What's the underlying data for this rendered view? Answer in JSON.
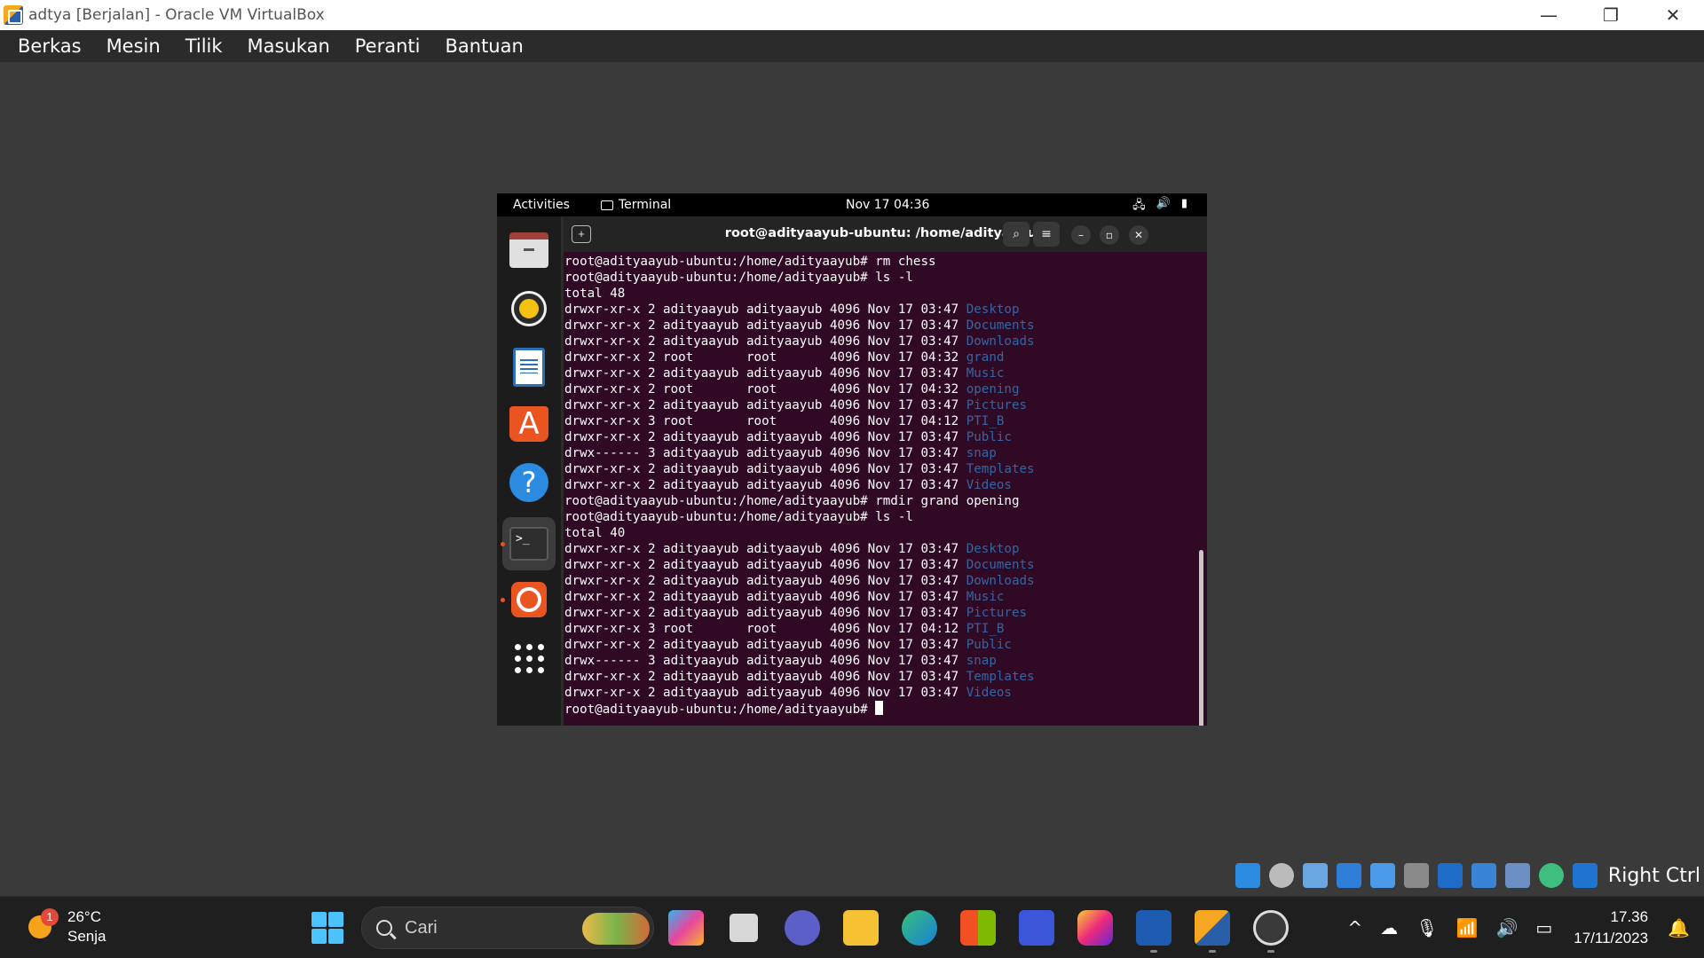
{
  "window": {
    "title": "adtya [Berjalan] - Oracle VM VirtualBox",
    "minimize_glyph": "—",
    "restore_glyph": "❐",
    "close_glyph": "✕"
  },
  "menubar": [
    "Berkas",
    "Mesin",
    "Tilik",
    "Masukan",
    "Peranti",
    "Bantuan"
  ],
  "guest": {
    "topbar": {
      "activities": "Activities",
      "app_name": "Terminal",
      "clock": "Nov 17  04:36"
    },
    "dock_items": [
      "files-icon",
      "rhythmbox-icon",
      "libreoffice-writer-icon",
      "app-center-icon",
      "help-icon",
      "terminal-icon",
      "ubuntu-icon",
      "show-apps-icon"
    ],
    "terminal": {
      "title": "root@adityaayub-ubuntu: /home/adityaayub",
      "lines": [
        [
          {
            "t": "root@adityaayub-ubuntu:/home/adityaayub# rm chess"
          }
        ],
        [
          {
            "t": "root@adityaayub-ubuntu:/home/adityaayub# ls -l"
          }
        ],
        [
          {
            "t": "total 48"
          }
        ],
        [
          {
            "t": "drwxr-xr-x 2 adityaayub adityaayub 4096 Nov 17 03:47 "
          },
          {
            "t": "Desktop",
            "c": "dir"
          }
        ],
        [
          {
            "t": "drwxr-xr-x 2 adityaayub adityaayub 4096 Nov 17 03:47 "
          },
          {
            "t": "Documents",
            "c": "dir"
          }
        ],
        [
          {
            "t": "drwxr-xr-x 2 adityaayub adityaayub 4096 Nov 17 03:47 "
          },
          {
            "t": "Downloads",
            "c": "dir"
          }
        ],
        [
          {
            "t": "drwxr-xr-x 2 root       root       4096 Nov 17 04:32 "
          },
          {
            "t": "grand",
            "c": "dir"
          }
        ],
        [
          {
            "t": "drwxr-xr-x 2 adityaayub adityaayub 4096 Nov 17 03:47 "
          },
          {
            "t": "Music",
            "c": "dir"
          }
        ],
        [
          {
            "t": "drwxr-xr-x 2 root       root       4096 Nov 17 04:32 "
          },
          {
            "t": "opening",
            "c": "dir"
          }
        ],
        [
          {
            "t": "drwxr-xr-x 2 adityaayub adityaayub 4096 Nov 17 03:47 "
          },
          {
            "t": "Pictures",
            "c": "dir"
          }
        ],
        [
          {
            "t": "drwxr-xr-x 3 root       root       4096 Nov 17 04:12 "
          },
          {
            "t": "PTI_B",
            "c": "dir"
          }
        ],
        [
          {
            "t": "drwxr-xr-x 2 adityaayub adityaayub 4096 Nov 17 03:47 "
          },
          {
            "t": "Public",
            "c": "dir"
          }
        ],
        [
          {
            "t": "drwx------ 3 adityaayub adityaayub 4096 Nov 17 03:47 "
          },
          {
            "t": "snap",
            "c": "dir"
          }
        ],
        [
          {
            "t": "drwxr-xr-x 2 adityaayub adityaayub 4096 Nov 17 03:47 "
          },
          {
            "t": "Templates",
            "c": "dir"
          }
        ],
        [
          {
            "t": "drwxr-xr-x 2 adityaayub adityaayub 4096 Nov 17 03:47 "
          },
          {
            "t": "Videos",
            "c": "dir"
          }
        ],
        [
          {
            "t": "root@adityaayub-ubuntu:/home/adityaayub# rmdir grand opening"
          }
        ],
        [
          {
            "t": "root@adityaayub-ubuntu:/home/adityaayub# ls -l"
          }
        ],
        [
          {
            "t": "total 40"
          }
        ],
        [
          {
            "t": "drwxr-xr-x 2 adityaayub adityaayub 4096 Nov 17 03:47 "
          },
          {
            "t": "Desktop",
            "c": "dir"
          }
        ],
        [
          {
            "t": "drwxr-xr-x 2 adityaayub adityaayub 4096 Nov 17 03:47 "
          },
          {
            "t": "Documents",
            "c": "dir"
          }
        ],
        [
          {
            "t": "drwxr-xr-x 2 adityaayub adityaayub 4096 Nov 17 03:47 "
          },
          {
            "t": "Downloads",
            "c": "dir"
          }
        ],
        [
          {
            "t": "drwxr-xr-x 2 adityaayub adityaayub 4096 Nov 17 03:47 "
          },
          {
            "t": "Music",
            "c": "dir"
          }
        ],
        [
          {
            "t": "drwxr-xr-x 2 adityaayub adityaayub 4096 Nov 17 03:47 "
          },
          {
            "t": "Pictures",
            "c": "dir"
          }
        ],
        [
          {
            "t": "drwxr-xr-x 3 root       root       4096 Nov 17 04:12 "
          },
          {
            "t": "PTI_B",
            "c": "dir"
          }
        ],
        [
          {
            "t": "drwxr-xr-x 2 adityaayub adityaayub 4096 Nov 17 03:47 "
          },
          {
            "t": "Public",
            "c": "dir"
          }
        ],
        [
          {
            "t": "drwx------ 3 adityaayub adityaayub 4096 Nov 17 03:47 "
          },
          {
            "t": "snap",
            "c": "dir"
          }
        ],
        [
          {
            "t": "drwxr-xr-x 2 adityaayub adityaayub 4096 Nov 17 03:47 "
          },
          {
            "t": "Templates",
            "c": "dir"
          }
        ],
        [
          {
            "t": "drwxr-xr-x 2 adityaayub adityaayub 4096 Nov 17 03:47 "
          },
          {
            "t": "Videos",
            "c": "dir"
          }
        ],
        [
          {
            "t": "root@adityaayub-ubuntu:/home/adityaayub# "
          },
          {
            "t": "",
            "c": "cursor"
          }
        ]
      ]
    }
  },
  "vbox_status": {
    "host_key": "Right Ctrl",
    "icons": [
      "hard-disk-icon",
      "optical-drive-icon",
      "audio-icon",
      "network-icon",
      "usb-icon",
      "shared-folders-icon",
      "display-icon",
      "recording-icon",
      "cpu-icon",
      "mouse-integration-icon",
      "capture-icon"
    ]
  },
  "taskbar": {
    "weather": {
      "temp": "26°C",
      "desc": "Senja",
      "badge": "1"
    },
    "search_placeholder": "Cari",
    "pinned_apps": [
      "copilot-icon",
      "task-view-icon",
      "teams-chat-icon",
      "file-explorer-icon",
      "edge-icon",
      "microsoft-store-icon",
      "visual-studio-icon",
      "instagram-icon",
      "virtualbox-taskbar-icon",
      "vm-running-icon",
      "obs-icon"
    ],
    "tray": {
      "chevron": "^",
      "time": "17.36",
      "date": "17/11/2023"
    }
  },
  "colors": {
    "terminal_bg": "#300a24",
    "dir_blue": "#3465a4",
    "ubuntu_orange": "#e95420",
    "windows_accent": "#4cc2ff"
  }
}
